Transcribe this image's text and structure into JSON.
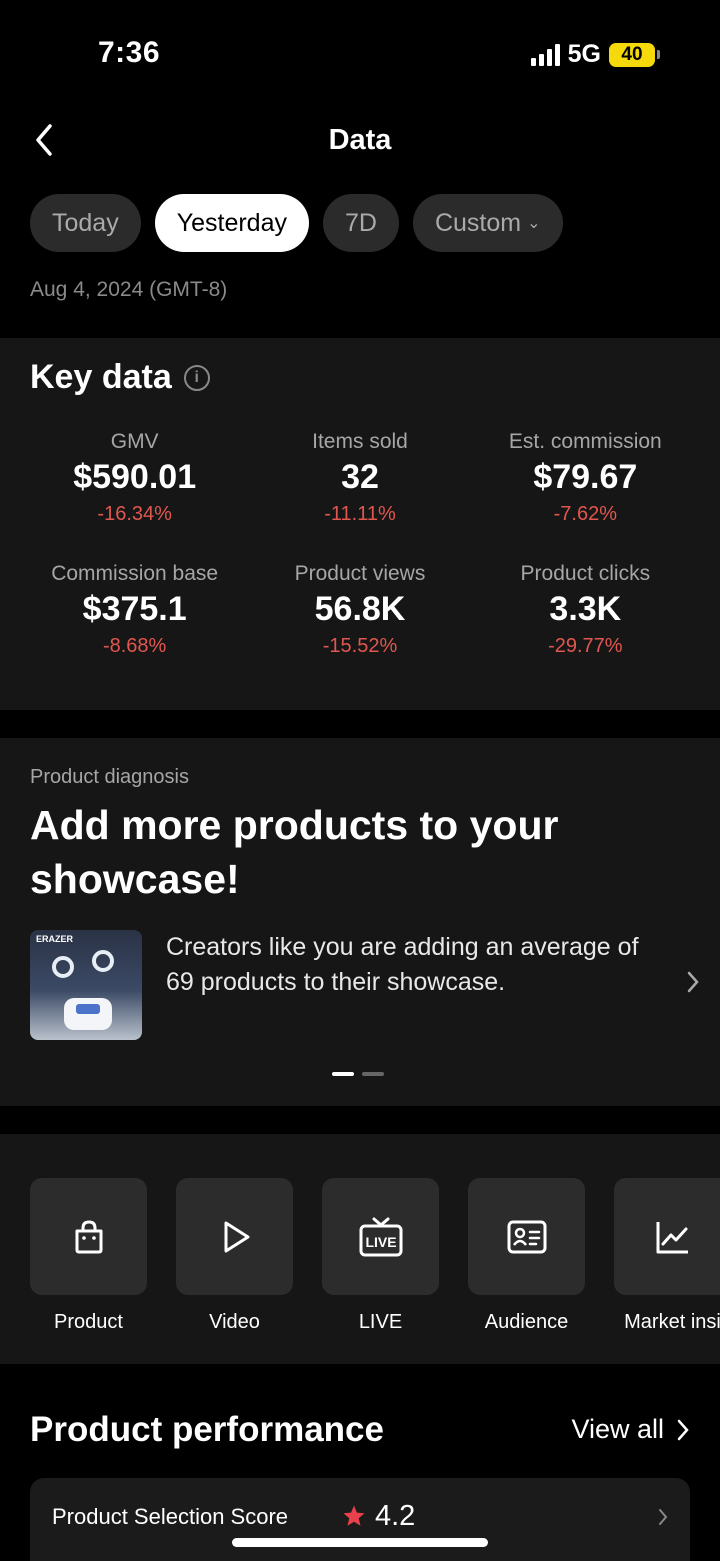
{
  "status_bar": {
    "time": "7:36",
    "network": "5G",
    "battery": "40"
  },
  "nav": {
    "title": "Data"
  },
  "filters": [
    {
      "label": "Today",
      "active": false
    },
    {
      "label": "Yesterday",
      "active": true
    },
    {
      "label": "7D",
      "active": false
    },
    {
      "label": "Custom",
      "active": false
    }
  ],
  "date_label": "Aug 4, 2024 (GMT-8)",
  "key_data": {
    "title": "Key data",
    "metrics": [
      {
        "label": "GMV",
        "value": "$590.01",
        "change": "-16.34%"
      },
      {
        "label": "Items sold",
        "value": "32",
        "change": "-11.11%"
      },
      {
        "label": "Est. commission",
        "value": "$79.67",
        "change": "-7.62%"
      },
      {
        "label": "Commission base",
        "value": "$375.1",
        "change": "-8.68%"
      },
      {
        "label": "Product views",
        "value": "56.8K",
        "change": "-15.52%"
      },
      {
        "label": "Product clicks",
        "value": "3.3K",
        "change": "-29.77%"
      }
    ]
  },
  "diagnosis": {
    "label": "Product diagnosis",
    "title": "Add more products to your showcase!",
    "thumb_brand": "ERAZER",
    "text": "Creators like you are adding an average of 69 products to their showcase.",
    "page_index": 1,
    "page_count": 2
  },
  "tools": [
    {
      "label": "Product",
      "icon": "shopping-bag-icon"
    },
    {
      "label": "Video",
      "icon": "play-icon"
    },
    {
      "label": "LIVE",
      "icon": "live-tv-icon"
    },
    {
      "label": "Audience",
      "icon": "id-card-icon"
    },
    {
      "label": "Market insi",
      "icon": "line-chart-icon"
    }
  ],
  "product_performance": {
    "title": "Product performance",
    "view_all": "View all",
    "score_label": "Product Selection Score",
    "score_value": "4.2",
    "star_color": "#e8414b"
  },
  "colors": {
    "negative": "#e0574f",
    "battery": "#f5d90a"
  }
}
